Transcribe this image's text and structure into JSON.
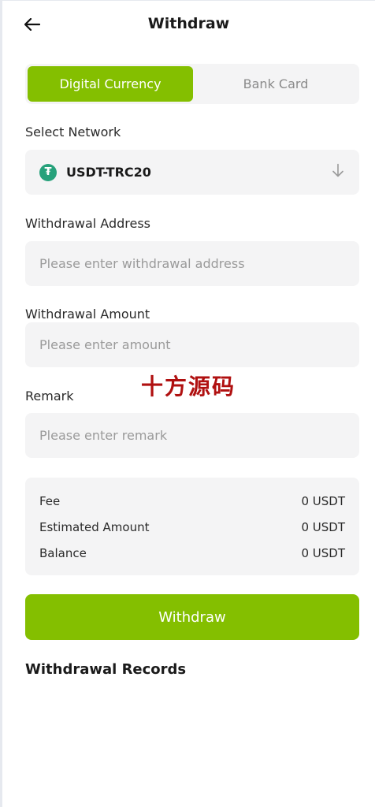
{
  "header": {
    "title": "Withdraw",
    "back_icon": "arrow-left-icon"
  },
  "tabs": [
    {
      "label": "Digital Currency",
      "active": true
    },
    {
      "label": "Bank Card",
      "active": false
    }
  ],
  "network": {
    "label": "Select Network",
    "value": "USDT-TRC20",
    "token_icon": "tether-icon",
    "token_glyph": "₮",
    "dropdown_icon": "arrow-down-icon"
  },
  "address": {
    "label": "Withdrawal Address",
    "placeholder": "Please enter withdrawal address"
  },
  "amount": {
    "label": "Withdrawal Amount",
    "placeholder": "Please enter amount"
  },
  "remark": {
    "label": "Remark",
    "placeholder": "Please enter remark"
  },
  "watermark": "十方源码",
  "summary": {
    "rows": [
      {
        "label": "Fee",
        "value": "0 USDT"
      },
      {
        "label": "Estimated Amount",
        "value": "0 USDT"
      },
      {
        "label": "Balance",
        "value": "0 USDT"
      }
    ]
  },
  "actions": {
    "withdraw_label": "Withdraw"
  },
  "records": {
    "title": "Withdrawal Records"
  },
  "colors": {
    "accent": "#84bf00",
    "field_bg": "#f4f4f5",
    "tether": "#26a17b"
  }
}
